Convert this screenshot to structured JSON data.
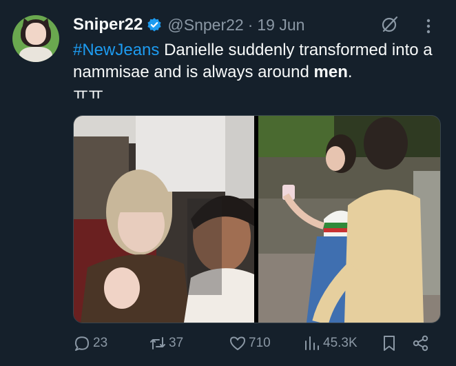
{
  "tweet": {
    "author_name": "Sniper22",
    "handle": "@Snper22",
    "separator": "·",
    "date": "19 Jun",
    "text": {
      "hashtag": "#NewJeans",
      "part1": " Danielle suddenly transformed into a nammisae and is always around ",
      "bold": "men",
      "part2": ".",
      "line2": "ㅠㅠ"
    },
    "stats": {
      "replies": "23",
      "retweets": "37",
      "likes": "710",
      "views": "45.3K"
    }
  },
  "colors": {
    "background": "#15202b",
    "text": "#f7f9f9",
    "secondary": "#8b98a5",
    "accent": "#1d9bf0"
  },
  "icons": {
    "verified": "verified-badge-icon",
    "grok": "grok-icon",
    "more": "more-vertical-icon",
    "reply": "reply-icon",
    "retweet": "retweet-icon",
    "like": "heart-icon",
    "views": "views-icon",
    "bookmark": "bookmark-icon",
    "share": "share-icon"
  }
}
